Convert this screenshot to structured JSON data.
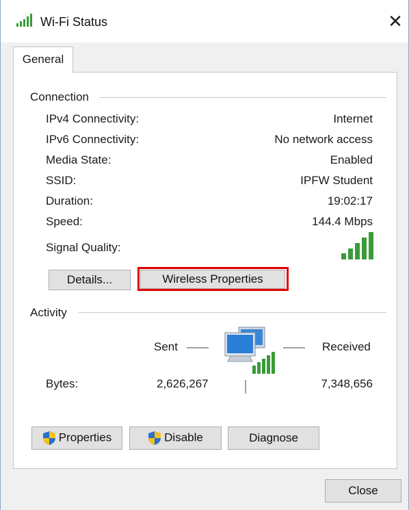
{
  "window": {
    "title": "Wi-Fi Status",
    "title_icon": "wifi-signal-icon",
    "close_glyph": "✕"
  },
  "tabs": [
    {
      "label": "General",
      "selected": true
    }
  ],
  "connection": {
    "section_label": "Connection",
    "rows": [
      {
        "label": "IPv4 Connectivity:",
        "value": "Internet"
      },
      {
        "label": "IPv6 Connectivity:",
        "value": "No network access"
      },
      {
        "label": "Media State:",
        "value": "Enabled"
      },
      {
        "label": "SSID:",
        "value": "IPFW Student"
      },
      {
        "label": "Duration:",
        "value": "19:02:17"
      },
      {
        "label": "Speed:",
        "value": "144.4 Mbps"
      }
    ],
    "signal_quality_label": "Signal Quality:",
    "signal_bars_filled": 5,
    "signal_bars_total": 5,
    "details_button": "Details...",
    "wireless_properties_button": "Wireless Properties"
  },
  "activity": {
    "section_label": "Activity",
    "sent_label": "Sent",
    "received_label": "Received",
    "bytes_label": "Bytes:",
    "bytes_sent": "2,626,267",
    "bytes_received": "7,348,656",
    "icon": "network-computers-icon"
  },
  "actions": {
    "properties_button": "Properties",
    "disable_button": "Disable",
    "diagnose_button": "Diagnose"
  },
  "footer": {
    "close_button": "Close"
  },
  "colors": {
    "signal_green": "#3a9b3a",
    "highlight_red": "#e00000",
    "button_bg": "#e1e1e1",
    "dialog_bg": "#f0f0f0"
  }
}
